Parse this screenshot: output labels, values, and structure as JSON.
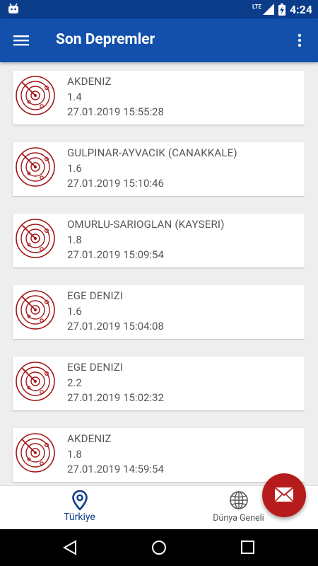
{
  "status_bar": {
    "network": "LTE",
    "time": "4:24"
  },
  "app_bar": {
    "title": "Son Depremler"
  },
  "earthquakes": [
    {
      "region": "AKDENIZ",
      "magnitude": "1.4",
      "datetime": "27.01.2019 15:55:28"
    },
    {
      "region": "GULPINAR-AYVACIK (CANAKKALE)",
      "magnitude": "1.6",
      "datetime": "27.01.2019 15:10:46"
    },
    {
      "region": "OMURLU-SARIOGLAN (KAYSERI)",
      "magnitude": "1.8",
      "datetime": "27.01.2019 15:09:54"
    },
    {
      "region": "EGE DENIZI",
      "magnitude": "1.6",
      "datetime": "27.01.2019 15:04:08"
    },
    {
      "region": "EGE DENIZI",
      "magnitude": "2.2",
      "datetime": "27.01.2019 15:02:32"
    },
    {
      "region": "AKDENIZ",
      "magnitude": "1.8",
      "datetime": "27.01.2019 14:59:54"
    }
  ],
  "bottom_nav": {
    "turkiye": "Türkiye",
    "world": "Dünya Geneli"
  },
  "colors": {
    "primary": "#1250ab",
    "status": "#0b3c8a",
    "accent": "#b71c1c"
  }
}
